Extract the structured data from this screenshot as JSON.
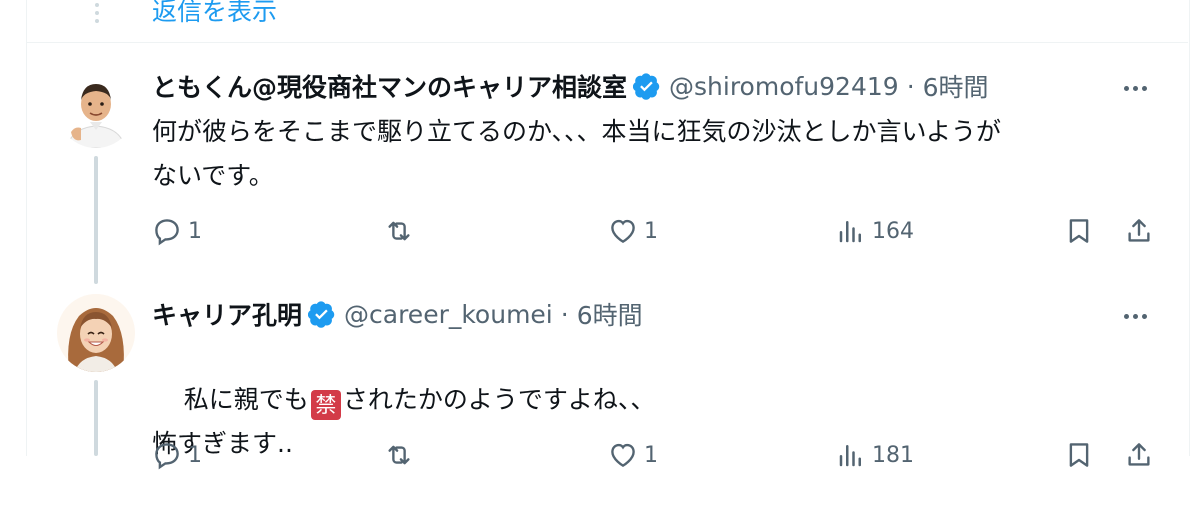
{
  "thread_top": {
    "show_replies_label": "返信を表示"
  },
  "tweets": [
    {
      "display_name": "ともくん@現役商社マンのキャリア相談室",
      "handle": "@shiromofu92419",
      "separator": "·",
      "time": "6時間",
      "text": "何が彼らをそこまで駆り立てるのか、、、本当に狂気の沙汰としか言いようが\nないです。",
      "actions": {
        "reply": "1",
        "retweet": "",
        "like": "1",
        "views": "164"
      }
    },
    {
      "display_name": "キャリア孔明",
      "handle": "@career_koumei",
      "separator": "·",
      "time": "6時間",
      "text_before_emoji": "私に親でも",
      "emoji_char": "禁",
      "text_after_emoji": "されたかのようですよね、、",
      "text_line2": "怖すぎます..",
      "actions": {
        "reply": "1",
        "retweet": "",
        "like": "1",
        "views": "181"
      }
    }
  ],
  "colors": {
    "accent": "#1d9bf0",
    "text": "#0f1419",
    "secondary": "#536471",
    "verified": "#1d9bf0",
    "prohibited_emoji": "#d33b48"
  },
  "icons": [
    "more-icon",
    "verified-badge-icon",
    "reply-icon",
    "retweet-icon",
    "like-icon",
    "views-icon",
    "bookmark-icon",
    "share-icon",
    "prohibited-emoji-icon"
  ]
}
